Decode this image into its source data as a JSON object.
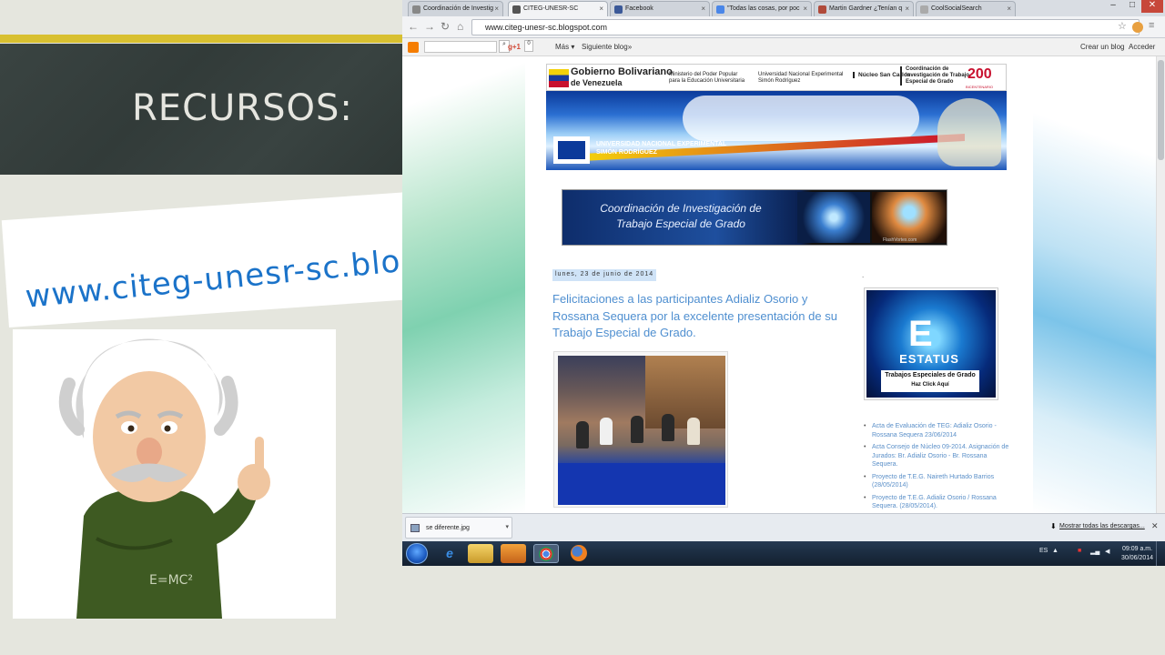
{
  "slide": {
    "title": "RECURSOS:",
    "url": "www.citeg-unesr-sc.blogspot.com",
    "colors": {
      "gold": "#d8c030",
      "chalkboard": "#343d3b",
      "url_blue": "#1b73c9"
    }
  },
  "browser": {
    "tabs": [
      {
        "label": "Coordinación de Investig",
        "icon": "page-icon"
      },
      {
        "label": "CITEG-UNESR-SC",
        "icon": "page-icon",
        "active": true
      },
      {
        "label": "Facebook",
        "icon": "facebook-icon"
      },
      {
        "label": "\"Todas las cosas, por poc",
        "icon": "google-icon"
      },
      {
        "label": "Martin Gardner ¿Tenían q",
        "icon": "page-icon"
      },
      {
        "label": "CoolSocialSearch",
        "icon": "page-icon"
      }
    ],
    "url": "www.citeg-unesr-sc.blogspot.com",
    "window_controls": {
      "minimize": "–",
      "maximize": "□",
      "close": "✕"
    }
  },
  "blogger_bar": {
    "gplus": "g+1",
    "mas": "Más ▾",
    "siguiente": "Siguiente blog»",
    "crear": "Crear un blog",
    "acceder": "Acceder"
  },
  "blog": {
    "gov": {
      "gob": "Gobierno Bolivariano",
      "ven": "de Venezuela",
      "ministerio": "Ministerio del Poder Popular\npara la Educación Universitaria",
      "universidad": "Universidad Nacional Experimental\nSimón Rodríguez",
      "nucleo": "Núcleo San Carlos",
      "coordinacion": "Coordinación de\nInvestigación de Trabajo\nEspecial de Grado",
      "bicentenario": "200",
      "bicentenario_label": "BICENTENARIO"
    },
    "header_univ": "UNIVERSIDAD NACIONAL EXPERIMENTAL\nSIMÓN RODRÍGUEZ",
    "coord_banner": {
      "line1": "Coordinación de Investigación de",
      "line2": "Trabajo Especial de Grado",
      "watermark": "FlashVortex.com"
    },
    "date": "lunes, 23 de junio de 2014",
    "post_title": "Felicitaciones a las participantes Adializ Osorio y Rossana Sequera por la excelente presentación de su Trabajo Especial de Grado.",
    "sidebar_dot": ".",
    "status_ad": {
      "big": "E",
      "title": "ESTATUS",
      "subtitle": "Trabajos Especiales de Grado",
      "cta": "Haz Click Aquí"
    },
    "links": [
      "Acta de Evaluación de TEG: Adializ Osorio - Rossana Sequera 23/06/2014",
      "Acta Consejo de Núcleo 09-2014. Asignación de Jurados: Br. Adializ Osorio - Br. Rossana Sequera.",
      "Proyecto de T.E.G. Naireth Hurtado Barrios (28/05/2014)",
      "Proyecto de T.E.G. Adializ Osorio / Rossana Sequera. (28/05/2014)."
    ]
  },
  "downloads": {
    "file": "se diferente.jpg",
    "show_all": "Mostrar todas las descargas...",
    "close": "✕"
  },
  "taskbar": {
    "lang": "ES",
    "time": "09:09 a.m.",
    "date": "30/06/2014"
  }
}
